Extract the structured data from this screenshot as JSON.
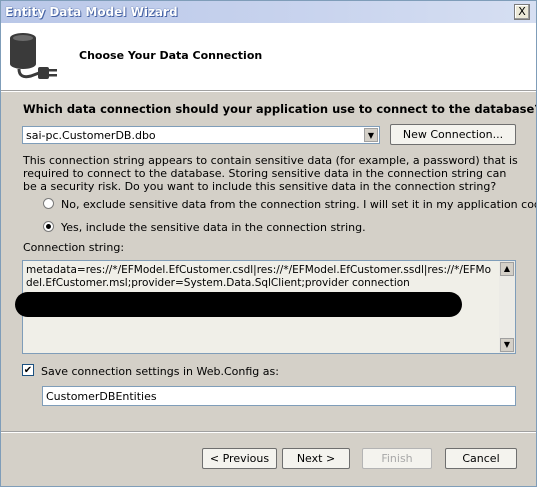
{
  "window": {
    "title": "Entity Data Model Wizard",
    "close_label": "X"
  },
  "header": {
    "heading": "Choose Your Data Connection"
  },
  "question": "Which data connection should your application use to connect to the database?",
  "connection_select": {
    "value": "sai-pc.CustomerDB.dbo"
  },
  "new_connection_label": "New Connection...",
  "sensitive_description": "This connection string appears to contain sensitive data (for example, a password) that is required to connect to the database. Storing sensitive data in the connection string can be a security risk. Do you want to include this sensitive data in the connection string?",
  "options": [
    {
      "label": "No, exclude sensitive data from the connection string. I will set it in my application code.",
      "selected": false
    },
    {
      "label": "Yes, include the sensitive data in the connection string.",
      "selected": true
    }
  ],
  "connection_string_label": "Connection string:",
  "connection_string": "metadata=res://*/EFModel.EfCustomer.csdl|res://*/EFModel.EfCustomer.ssdl|res://*/EFModel.EfCustomer.msl;provider=System.Data.SqlClient;provider connection",
  "save_settings": {
    "label": "Save connection settings in Web.Config as:",
    "checked": true
  },
  "entity_name": "CustomerDBEntities",
  "buttons": {
    "previous": "< Previous",
    "next": "Next >",
    "finish": "Finish",
    "cancel": "Cancel"
  }
}
